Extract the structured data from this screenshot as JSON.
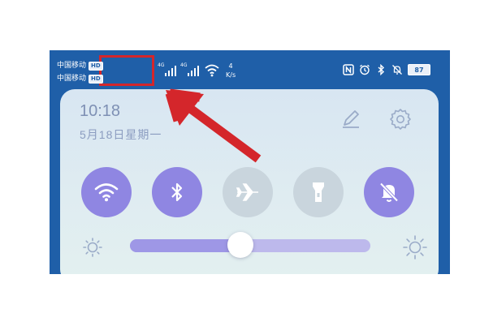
{
  "colors": {
    "statusbar_bg": "#1f5fa8",
    "annotation_red": "#d4262b",
    "toggle_on": "#8f86e2",
    "toggle_off": "#c9d5dd",
    "slider_track": "#bdb9ec"
  },
  "status_bar": {
    "carrier_1": "中国移动",
    "carrier_2": "中国移动",
    "hd_badge": "HD",
    "network_type_1": "4G",
    "network_type_2": "4G",
    "speed_value": "4",
    "speed_unit": "K/s",
    "battery": "87",
    "icons": [
      "nfc-icon",
      "alarm-icon",
      "bluetooth-icon",
      "bell-mute-icon",
      "battery-icon"
    ]
  },
  "panel": {
    "time": "10:18",
    "date": "5月18日星期一",
    "edit_icon": "pen-icon",
    "settings_icon": "gear-icon"
  },
  "toggles": [
    {
      "name": "wifi",
      "icon": "wifi-icon",
      "state": "on"
    },
    {
      "name": "bluetooth",
      "icon": "bluetooth-icon",
      "state": "on"
    },
    {
      "name": "airplane-mode",
      "icon": "airplane-icon",
      "state": "off"
    },
    {
      "name": "flashlight",
      "icon": "flashlight-icon",
      "state": "off"
    },
    {
      "name": "mute",
      "icon": "bell-mute-icon",
      "state": "on"
    }
  ],
  "brightness": {
    "level": 0.46,
    "low_icon": "sun-low-icon",
    "high_icon": "sun-high-icon"
  },
  "annotation": {
    "type": "arrow",
    "target": "carrier-labels"
  }
}
